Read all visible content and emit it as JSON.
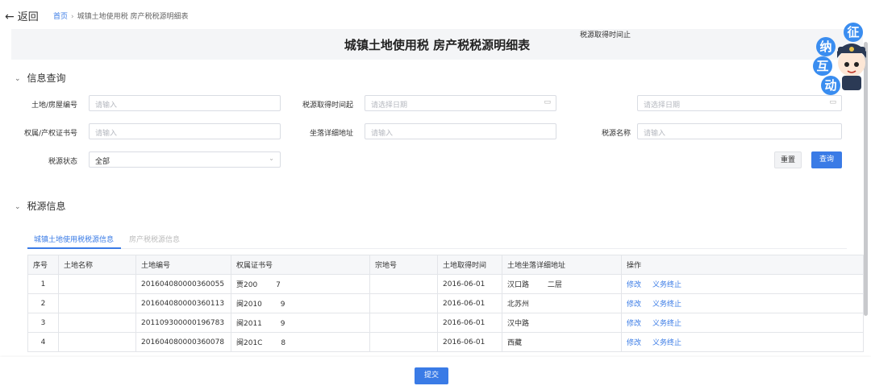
{
  "nav": {
    "back_label": "返回",
    "breadcrumb_home": "首页",
    "breadcrumb_current": "城镇土地使用税 房产税税源明细表"
  },
  "page_title": "城镇土地使用税 房产税税源明细表",
  "query_section": {
    "title": "信息查询",
    "fields": {
      "land_no": {
        "label": "土地/房屋编号",
        "placeholder": "请输入"
      },
      "start_date": {
        "label": "税源取得时间起",
        "placeholder": "请选择日期"
      },
      "end_date": {
        "label": "税源取得时间止",
        "placeholder": "请选择日期"
      },
      "cert_no": {
        "label": "权属/产权证书号",
        "placeholder": "请输入"
      },
      "address": {
        "label": "坐落详细地址",
        "placeholder": "请输入"
      },
      "source_name": {
        "label": "税源名称",
        "placeholder": "请输入"
      },
      "status": {
        "label": "税源状态",
        "value": "全部"
      }
    },
    "reset_label": "重置",
    "query_label": "查询"
  },
  "source_section": {
    "title": "税源信息",
    "tabs": [
      "城镇土地使用税税源信息",
      "房产税税源信息"
    ],
    "columns": [
      "序号",
      "土地名称",
      "土地编号",
      "权属证书号",
      "宗地号",
      "土地取得时间",
      "土地坐落详细地址",
      "操作"
    ],
    "rows": [
      {
        "no": "1",
        "name": "",
        "land_no": "201604080000360055",
        "cert_no": "贾200        7",
        "parcel": "",
        "date": "2016-06-01",
        "address": "汉口路        二层"
      },
      {
        "no": "2",
        "name": "",
        "land_no": "201604080000360113",
        "cert_no": "闽2010        9",
        "parcel": "",
        "date": "2016-06-01",
        "address": "北苏州"
      },
      {
        "no": "3",
        "name": "",
        "land_no": "201109300000196783",
        "cert_no": "闽2011        9",
        "parcel": "",
        "date": "2016-06-01",
        "address": "汉中路"
      },
      {
        "no": "4",
        "name": "",
        "land_no": "201604080000360078",
        "cert_no": "闽201C        8",
        "parcel": "",
        "date": "2016-06-01",
        "address": "西藏"
      }
    ],
    "actions": {
      "edit": "修改",
      "terminate": "义务终止"
    }
  },
  "submit_label": "提交",
  "mascot": {
    "chars": [
      "征",
      "纳",
      "互",
      "动"
    ]
  },
  "colors": {
    "accent": "#3a7be6",
    "title_bg": "#f4f5f7"
  }
}
